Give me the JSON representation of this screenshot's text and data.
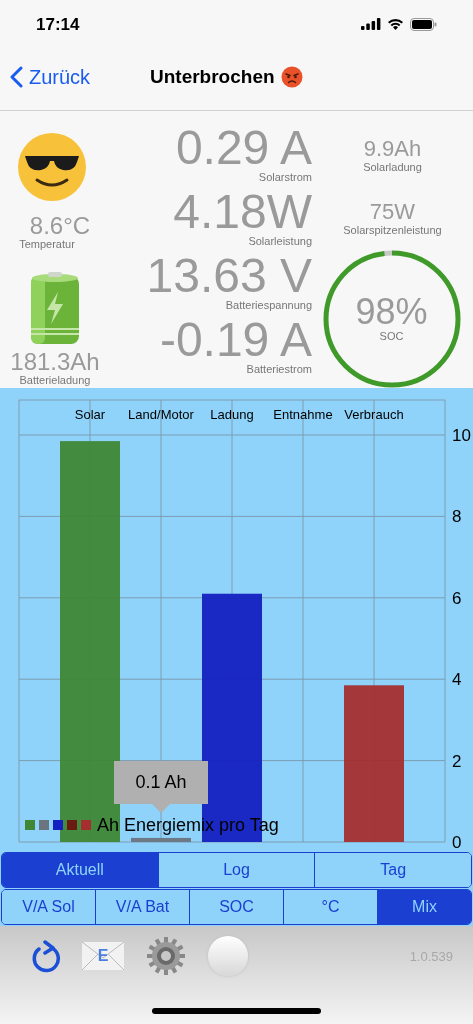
{
  "status_bar": {
    "time": "17:14"
  },
  "nav": {
    "back": "Zurück",
    "title": "Unterbrochen"
  },
  "weather": {
    "value": "8.6°C",
    "label": "Temperatur"
  },
  "battery": {
    "value": "181.3Ah",
    "label": "Batterieladung"
  },
  "center_readings": [
    {
      "value": "0.29 A",
      "label": "Solarstrom"
    },
    {
      "value": "4.18W",
      "label": "Solarleistung"
    },
    {
      "value": "13.63 V",
      "label": "Batteriespannung"
    },
    {
      "value": "-0.19 A",
      "label": "Batteriestrom"
    }
  ],
  "right_readings": [
    {
      "value": "9.9Ah",
      "label": "Solarladung"
    },
    {
      "value": "75W",
      "label": "Solarspitzenleistung"
    }
  ],
  "soc": {
    "value": "98%",
    "label": "SOC",
    "level": 0.98
  },
  "chart": {
    "chart_data": {
      "type": "bar",
      "categories": [
        "Solar",
        "Land/Motor",
        "Ladung",
        "Entnahme",
        "Verbrauch"
      ],
      "series": [
        {
          "name": "Ah Energiemix pro Tag",
          "values": [
            9.85,
            0.1,
            6.1,
            0,
            3.85
          ]
        }
      ],
      "ylim": [
        0,
        10.86
      ],
      "grid": true,
      "yticks": [
        0,
        2,
        4,
        6,
        8,
        10
      ]
    },
    "tooltip": "0.1 Ah",
    "legend": {
      "swatches": [
        {
          "color": "#3f8735"
        },
        {
          "color": "#6b7580"
        },
        {
          "color": "#1420c0"
        },
        {
          "color": "#6b1c12"
        },
        {
          "color": "#a52e2e"
        }
      ]
    }
  },
  "main_tabs": [
    {
      "label": "Aktuell",
      "selected": true
    },
    {
      "label": "Log",
      "selected": false
    },
    {
      "label": "Tag",
      "selected": false
    }
  ],
  "sub_tabs": [
    {
      "label": "V/A Sol",
      "selected": false
    },
    {
      "label": "V/A Bat",
      "selected": false
    },
    {
      "label": "SOC",
      "selected": false
    },
    {
      "label": "°C",
      "selected": false
    },
    {
      "label": "Mix",
      "selected": true
    }
  ],
  "toolbar": {
    "mail_letter": "E",
    "version": "1.0.539"
  }
}
